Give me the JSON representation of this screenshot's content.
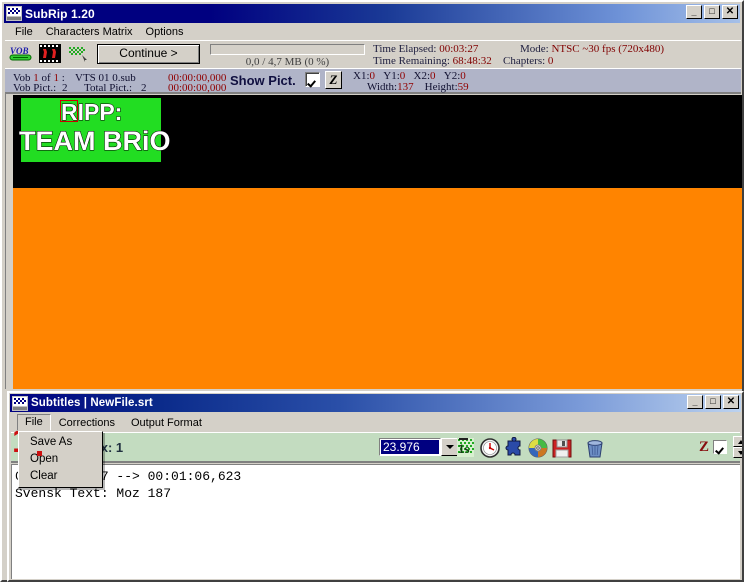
{
  "app": {
    "title": "SubRip 1.20",
    "icon": "subrip-app-icon",
    "window_buttons": {
      "minimize": "_",
      "maximize": "□",
      "close": "✕"
    },
    "menubar": [
      {
        "label": "File",
        "name": "menu-file"
      },
      {
        "label": "Characters Matrix",
        "name": "menu-characters-matrix"
      },
      {
        "label": "Options",
        "name": "menu-options"
      }
    ],
    "toolbar": {
      "vob_icon": "vob-logo-icon",
      "film_icon": "film-strip-icon",
      "bitmap_icon": "bitmap-text-icon",
      "continue_label": "Continue  >",
      "progress": {
        "value": 0,
        "max": 100,
        "label": "0,0 / 4,7 MB (0 %)"
      }
    },
    "status": {
      "time_elapsed_label": "Time Elapsed:",
      "time_elapsed_value": "00:03:27",
      "time_remaining_label": "Time Remaining:",
      "time_remaining_value": "68:48:32",
      "mode_label": "Mode:",
      "mode_value": "NTSC ~30 fps (720x480)",
      "chapters_label": "Chapters:",
      "chapters_value": "0"
    },
    "vobinfo": {
      "vob_prefix": "Vob",
      "vob_num": "1",
      "of_label": "of",
      "vob_total": "1",
      "colon": ":",
      "vts_label": "VTS  01  0.sub",
      "timecode_1": "00:00:00,000",
      "timecode_2": "00:00:00,000",
      "vob_pict_label": "Vob Pict.:",
      "vob_pict_value": "2",
      "total_pict_label": "Total Pict.:",
      "total_pict_value": "2",
      "show_pict_label": "Show Pict.",
      "show_pict_checked": true,
      "z_button_label": "Z"
    },
    "coords": {
      "x1_label": "X1:",
      "x1_value": "0",
      "y1_label": "Y1:",
      "y1_value": "0",
      "x2_label": "X2:",
      "x2_value": "0",
      "y2_label": "Y2:",
      "y2_value": "0",
      "width_label": "Width:",
      "width_value": "137",
      "height_label": "Height:",
      "height_value": "59"
    },
    "canvas": {
      "background": "#000000",
      "band_color": "#ff8400",
      "selection_color": "#22dd22",
      "subtitle_line_1": "RIPP:",
      "subtitle_line_2": "TEAM BRiO",
      "char_highlight_color": "#cc0000"
    }
  },
  "subs": {
    "title": "Subtitles | NewFile.srt",
    "icon": "subtitles-window-icon",
    "window_buttons": {
      "minimize": "_",
      "maximize": "□",
      "close": "✕"
    },
    "menubar": [
      {
        "label": "File",
        "name": "menu-file",
        "open": true
      },
      {
        "label": "Corrections",
        "name": "menu-corrections",
        "open": false
      },
      {
        "label": "Output Format",
        "name": "menu-output-format",
        "open": false
      }
    ],
    "file_menu_items": [
      {
        "label": "Save As",
        "name": "menu-item-save-as"
      },
      {
        "label": "Open",
        "name": "menu-item-open"
      },
      {
        "label": "Clear",
        "name": "menu-item-clear"
      }
    ],
    "toolbar": {
      "index_label": "Index: 1",
      "fps_value": "23.976",
      "fps_placeholder": "fps",
      "icons": [
        {
          "name": "time-scale-icon",
          "glyph": "1s"
        },
        {
          "name": "clock-icon",
          "glyph": "clock"
        },
        {
          "name": "puzzle-piece-icon",
          "glyph": "puzzle"
        },
        {
          "name": "cd-disc-icon",
          "glyph": "disc"
        },
        {
          "name": "save-floppy-icon",
          "glyph": "floppy"
        },
        {
          "name": "trash-bin-icon",
          "glyph": "trash"
        }
      ],
      "z_label": "Z",
      "z_checked": true,
      "spinner_up": "▲",
      "spinner_down": "▼"
    },
    "text_content": "00:01:00,027 --> 00:01:06,623\nSvensk Text: Moz 187",
    "overlay_number": "1"
  },
  "colors": {
    "face": "#d4d0c8",
    "title_active": "#000080",
    "status_band": "#b0b4c8",
    "green_toolbar": "#c3dcc0",
    "orange": "#ff8400",
    "selection_green": "#22dd22",
    "accent_red": "#900000",
    "highlight_blue": "#000080"
  }
}
